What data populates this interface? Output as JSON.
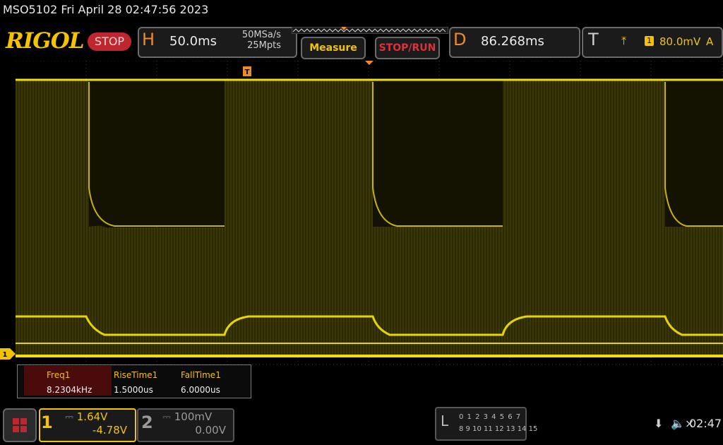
{
  "status_line": "MSO5102  Fri April 28 02:47:56 2023",
  "brand": "RIGOL",
  "run_state": "STOP",
  "horizontal": {
    "letter": "H",
    "timebase": "50.0ms",
    "sample_rate": "50MSa/s",
    "memory_depth": "25Mpts"
  },
  "buttons": {
    "measure": "Measure",
    "stop_run": "STOP/RUN"
  },
  "delay": {
    "letter": "D",
    "value": "86.268ms"
  },
  "trigger": {
    "letter": "T",
    "edge_icon": "rising-edge-icon",
    "edge_glyph": "⤒",
    "source": "1",
    "level": "80.0mV",
    "mode": "A"
  },
  "ch1_marker": "1",
  "measurements": [
    {
      "name": "Freq1",
      "value": "8.2304kHz"
    },
    {
      "name": "RiseTime1",
      "value": "1.5000us"
    },
    {
      "name": "FallTime1",
      "value": "6.0000us"
    }
  ],
  "channel1": {
    "number": "1",
    "coupling_icon": "dc-coupling-icon",
    "scale": "1.64V",
    "offset": "-4.78V"
  },
  "channel2": {
    "number": "2",
    "coupling_icon": "dc-coupling-icon",
    "scale": "100mV",
    "offset": "0.00V"
  },
  "logic_analyzer": {
    "letter": "L",
    "row1": "0 1 2 3  4 5 6 7",
    "row2": "8 9 10 11  12 13 14 15"
  },
  "clock": "02:47",
  "colors": {
    "trace": "#f3c300",
    "accent_orange": "#f08a24",
    "stop_red": "#c0262d"
  }
}
